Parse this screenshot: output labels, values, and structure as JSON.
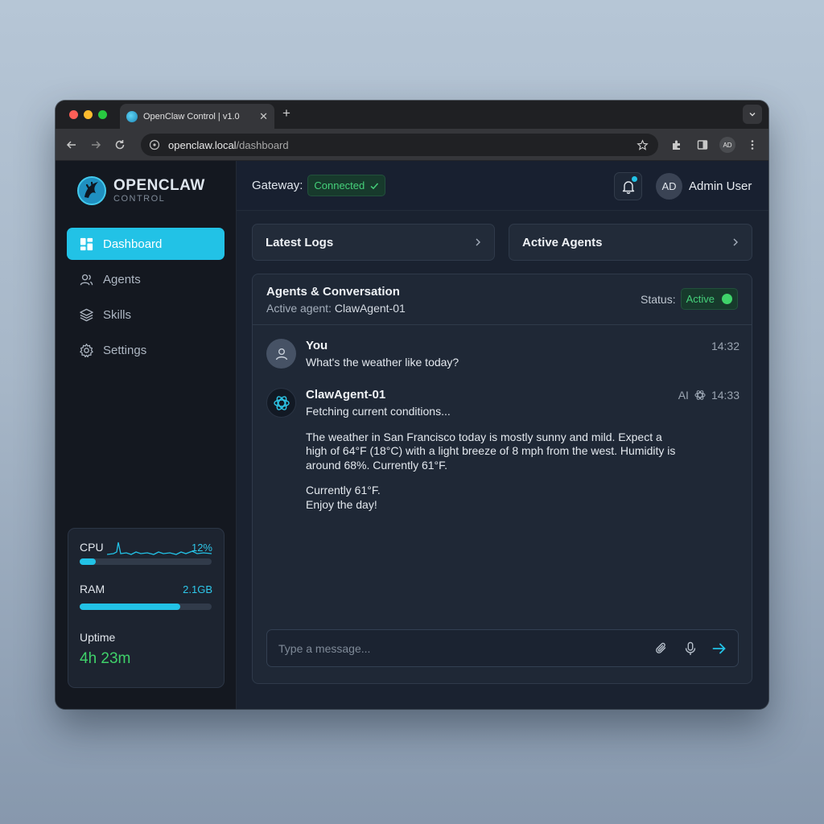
{
  "browser": {
    "tab_title": "OpenClaw Control | v1.0",
    "url_host": "openclaw.local",
    "url_path": "/dashboard",
    "profile_initials": "AD"
  },
  "brand": {
    "name": "OPENCLAW",
    "subtitle": "CONTROL"
  },
  "sidebar": {
    "items": [
      {
        "label": "Dashboard",
        "icon": "dashboard-icon",
        "active": true
      },
      {
        "label": "Agents",
        "icon": "users-icon",
        "active": false
      },
      {
        "label": "Skills",
        "icon": "layers-icon",
        "active": false
      },
      {
        "label": "Settings",
        "icon": "gear-icon",
        "active": false
      }
    ]
  },
  "stats": {
    "cpu": {
      "label": "CPU",
      "value": "12%",
      "fraction": 0.12
    },
    "ram": {
      "label": "RAM",
      "value": "2.1GB",
      "fraction": 0.76
    },
    "uptime": {
      "label": "Uptime",
      "value": "4h 23m"
    }
  },
  "topbar": {
    "gateway_label": "Gateway:",
    "gateway_status": "Connected",
    "user_initials": "AD",
    "user_name": "Admin User"
  },
  "cards": {
    "logs": "Latest Logs",
    "agents": "Active Agents"
  },
  "chat": {
    "title": "Agents & Conversation",
    "active_agent_label": "Active agent:",
    "active_agent": "ClawAgent-01",
    "status_label": "Status:",
    "status_value": "Active",
    "messages": [
      {
        "author": "You",
        "time": "14:32",
        "text": "What's the weather like today?"
      },
      {
        "author": "ClawAgent-01",
        "tag": "AI",
        "time": "14:33",
        "lines": [
          "Fetching current conditions...",
          "The weather in San Francisco today is mostly sunny and mild. Expect a high of 64°F (18°C) with a light breeze of 8 mph from the west. Humidity is around 68%. Currently 61°F.",
          "Currently 61°F.",
          "Enjoy the day!"
        ]
      }
    ],
    "composer_placeholder": "Type a message..."
  },
  "colors": {
    "accent": "#22c2e6",
    "success": "#3fd26a",
    "sidebar_bg": "#141820",
    "main_bg": "#1a2230"
  }
}
